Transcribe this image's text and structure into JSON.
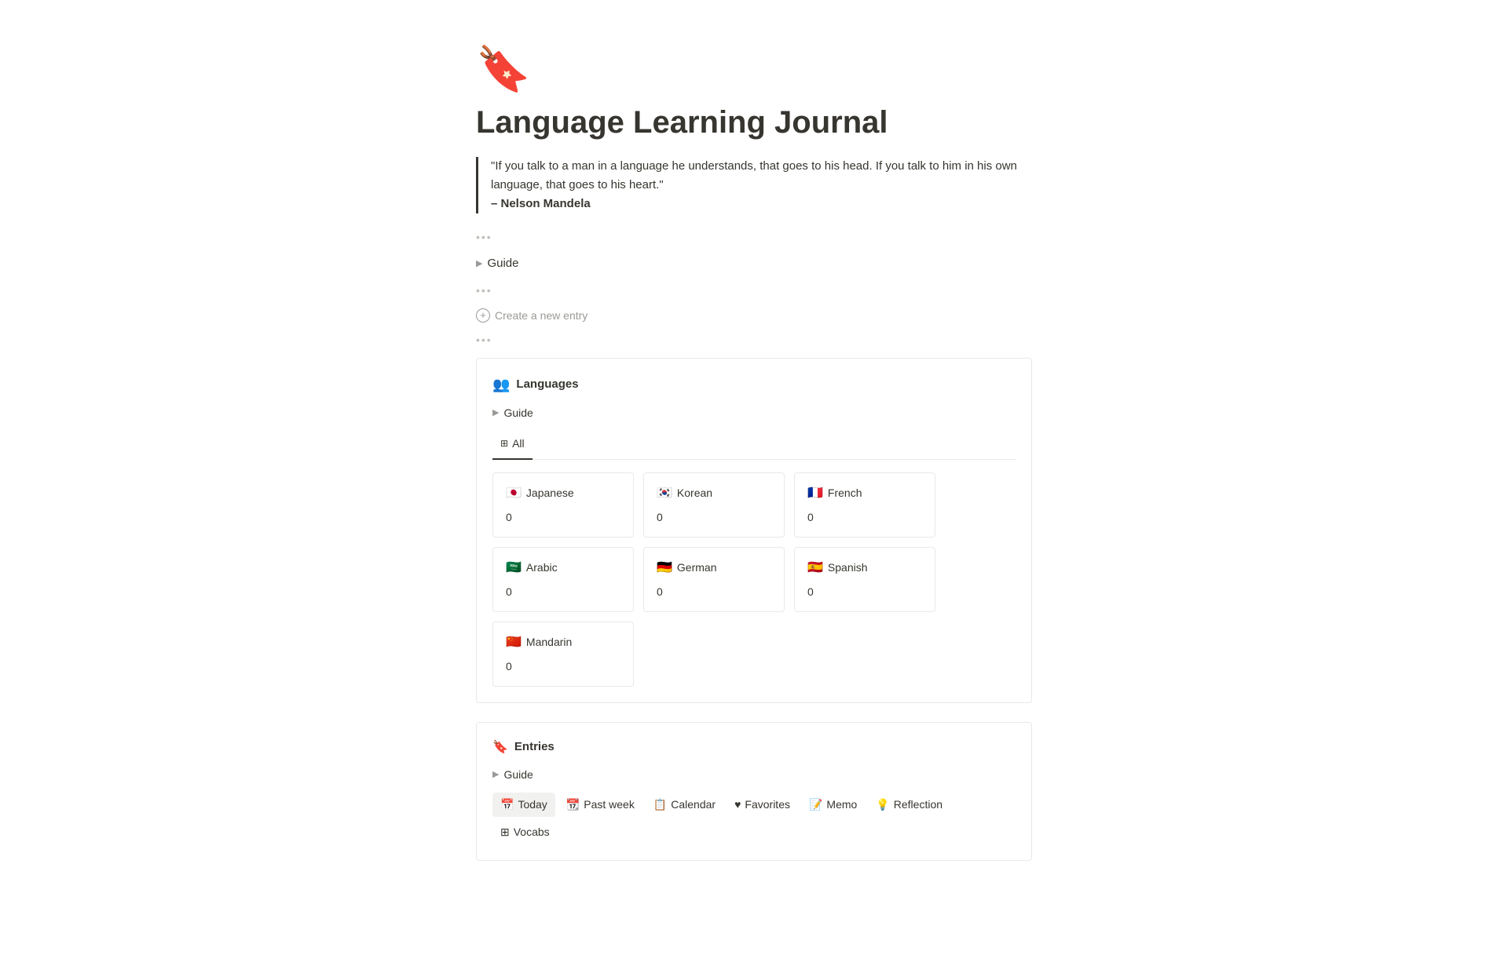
{
  "page": {
    "icon": "🔖",
    "title": "Language Learning Journal",
    "quote": {
      "text": "\"If you talk to a man in a language he understands, that goes to his head. If you talk to him in his own language, that goes to his heart.\"",
      "author": "– Nelson Mandela"
    },
    "dots1": "•••",
    "guide_label": "Guide",
    "dots2": "•••",
    "create_entry_label": "Create a new entry",
    "dots3": "•••"
  },
  "languages_db": {
    "icon": "👥",
    "title": "Languages",
    "guide_label": "Guide",
    "tabs": [
      {
        "label": "All",
        "icon": "⊞",
        "active": true
      }
    ],
    "cards": [
      {
        "flag": "🇯🇵",
        "name": "Japanese",
        "count": "0"
      },
      {
        "flag": "🇰🇷",
        "name": "Korean",
        "count": "0"
      },
      {
        "flag": "🇫🇷",
        "name": "French",
        "count": "0"
      },
      {
        "flag": "🇸🇦",
        "name": "Arabic",
        "count": "0"
      },
      {
        "flag": "🇩🇪",
        "name": "German",
        "count": "0"
      },
      {
        "flag": "🇪🇸",
        "name": "Spanish",
        "count": "0"
      },
      {
        "flag": "🇨🇳",
        "name": "Mandarin",
        "count": "0"
      }
    ]
  },
  "entries_db": {
    "bookmark_icon": "🔖",
    "title": "Entries",
    "guide_label": "Guide",
    "tabs": [
      {
        "label": "Today",
        "icon": "📅",
        "active": true
      },
      {
        "label": "Past week",
        "icon": "📆"
      },
      {
        "label": "Calendar",
        "icon": "📋"
      },
      {
        "label": "Favorites",
        "icon": "♥"
      },
      {
        "label": "Memo",
        "icon": "📝"
      },
      {
        "label": "Reflection",
        "icon": "💡"
      },
      {
        "label": "Vocabs",
        "icon": "⊞"
      }
    ]
  }
}
